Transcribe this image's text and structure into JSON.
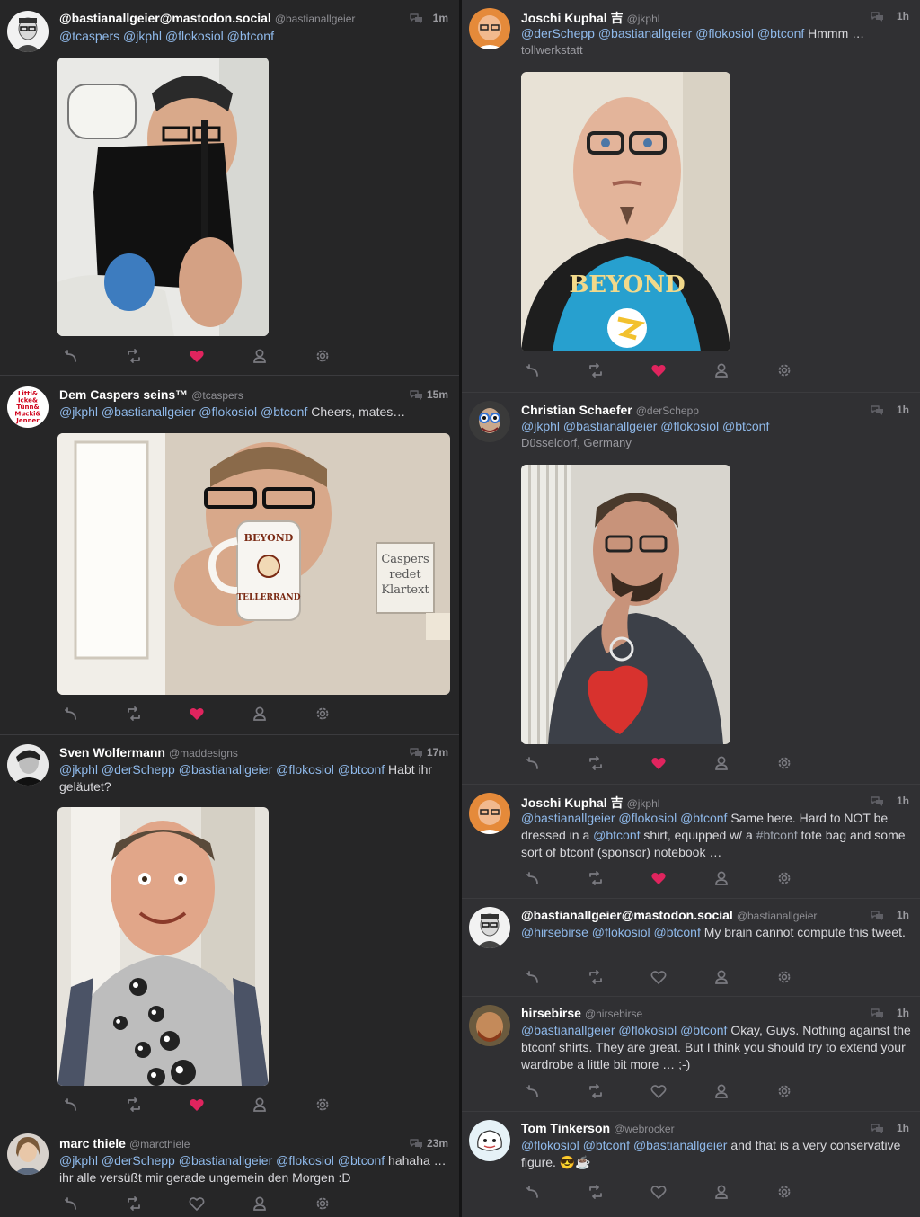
{
  "left_column": [
    {
      "name": "@bastianallgeier@mastodon.social",
      "handle": "@bastianallgeier",
      "time": "1m",
      "text_parts": [
        {
          "t": "@tcaspers",
          "k": "mention"
        },
        {
          "t": " ",
          "k": "text"
        },
        {
          "t": "@jkphl",
          "k": "mention"
        },
        {
          "t": " ",
          "k": "text"
        },
        {
          "t": "@flokosiol",
          "k": "mention"
        },
        {
          "t": " ",
          "k": "text"
        },
        {
          "t": "@btconf",
          "k": "mention"
        }
      ],
      "has_photo": true,
      "liked": true,
      "avatar_icon": "person-glasses-avatar"
    },
    {
      "name": "Dem Caspers seins™",
      "handle": "@tcaspers",
      "time": "15m",
      "text_parts": [
        {
          "t": "@jkphl",
          "k": "mention"
        },
        {
          "t": " ",
          "k": "text"
        },
        {
          "t": "@bastianallgeier",
          "k": "mention"
        },
        {
          "t": " ",
          "k": "text"
        },
        {
          "t": "@flokosiol",
          "k": "mention"
        },
        {
          "t": " ",
          "k": "text"
        },
        {
          "t": "@btconf",
          "k": "mention"
        },
        {
          "t": " Cheers, mates…",
          "k": "text"
        }
      ],
      "has_photo": true,
      "liked": true,
      "avatar_text": [
        "Litti&",
        "Icke&",
        "Tünn&",
        "Mucki&",
        "Jenner"
      ],
      "photo_texts": [
        "BEYOND",
        "TELLERRAND",
        "Caspers",
        "redet",
        "Klartext"
      ]
    },
    {
      "name": "Sven Wolfermann",
      "handle": "@maddesigns",
      "time": "17m",
      "text_parts": [
        {
          "t": "@jkphl",
          "k": "mention"
        },
        {
          "t": " ",
          "k": "text"
        },
        {
          "t": "@derSchepp",
          "k": "mention"
        },
        {
          "t": " ",
          "k": "text"
        },
        {
          "t": "@bastianallgeier",
          "k": "mention"
        },
        {
          "t": " ",
          "k": "text"
        },
        {
          "t": "@flokosiol",
          "k": "mention"
        },
        {
          "t": " ",
          "k": "text"
        },
        {
          "t": "@btconf",
          "k": "mention"
        },
        {
          "t": " Habt ihr geläutet?",
          "k": "text"
        }
      ],
      "has_photo": true,
      "liked": true
    },
    {
      "name": "marc thiele",
      "handle": "@marcthiele",
      "time": "23m",
      "text_parts": [
        {
          "t": "@jkphl",
          "k": "mention"
        },
        {
          "t": " ",
          "k": "text"
        },
        {
          "t": "@derSchepp",
          "k": "mention"
        },
        {
          "t": " ",
          "k": "text"
        },
        {
          "t": "@bastianallgeier",
          "k": "mention"
        },
        {
          "t": " ",
          "k": "text"
        },
        {
          "t": "@flokosiol",
          "k": "mention"
        },
        {
          "t": " ",
          "k": "text"
        },
        {
          "t": "@btconf",
          "k": "mention"
        },
        {
          "t": " hahaha … ihr alle versüßt mir gerade ungemein den Morgen :D",
          "k": "text"
        }
      ],
      "has_photo": false,
      "liked": false
    }
  ],
  "right_column": [
    {
      "name": "Joschi Kuphal 吉",
      "handle": "@jkphl",
      "time": "1h",
      "text_parts": [
        {
          "t": "@derSchepp",
          "k": "mention"
        },
        {
          "t": " ",
          "k": "text"
        },
        {
          "t": "@bastianallgeier",
          "k": "mention"
        },
        {
          "t": " ",
          "k": "text"
        },
        {
          "t": "@flokosiol",
          "k": "mention"
        },
        {
          "t": " ",
          "k": "text"
        },
        {
          "t": "@btconf",
          "k": "mention"
        },
        {
          "t": " Hmmm …",
          "k": "text"
        }
      ],
      "place": "tollwerkstatt",
      "has_photo": true,
      "liked": true,
      "photo_texts": [
        "BEYOND"
      ]
    },
    {
      "name": "Christian Schaefer",
      "handle": "@derSchepp",
      "time": "1h",
      "text_parts": [
        {
          "t": "@jkphl",
          "k": "mention"
        },
        {
          "t": " ",
          "k": "text"
        },
        {
          "t": "@bastianallgeier",
          "k": "mention"
        },
        {
          "t": " ",
          "k": "text"
        },
        {
          "t": "@flokosiol",
          "k": "mention"
        },
        {
          "t": " ",
          "k": "text"
        },
        {
          "t": "@btconf",
          "k": "mention"
        }
      ],
      "place": "Düsseldorf, Germany",
      "has_photo": true,
      "liked": true
    },
    {
      "name": "Joschi Kuphal 吉",
      "handle": "@jkphl",
      "time": "1h",
      "text_parts": [
        {
          "t": "@bastianallgeier",
          "k": "mention"
        },
        {
          "t": " ",
          "k": "text"
        },
        {
          "t": "@flokosiol",
          "k": "mention"
        },
        {
          "t": " ",
          "k": "text"
        },
        {
          "t": "@btconf",
          "k": "mention"
        },
        {
          "t": " Same here. Hard to NOT be dressed in a ",
          "k": "text"
        },
        {
          "t": "@btconf",
          "k": "mention"
        },
        {
          "t": " shirt, equipped w/ a ",
          "k": "text"
        },
        {
          "t": "#btconf",
          "k": "hashtag"
        },
        {
          "t": " tote bag and some sort of btconf (sponsor) notebook …",
          "k": "text"
        }
      ],
      "has_photo": false,
      "liked": true
    },
    {
      "name": "@bastianallgeier@mastodon.social",
      "handle": "@bastianallgeier",
      "time": "1h",
      "text_parts": [
        {
          "t": "@hirsebirse",
          "k": "mention"
        },
        {
          "t": " ",
          "k": "text"
        },
        {
          "t": "@flokosiol",
          "k": "mention"
        },
        {
          "t": " ",
          "k": "text"
        },
        {
          "t": "@btconf",
          "k": "mention"
        },
        {
          "t": " My brain cannot compute this tweet.",
          "k": "text"
        }
      ],
      "has_photo": false,
      "liked": false
    },
    {
      "name": "hirsebirse",
      "handle": "@hirsebirse",
      "time": "1h",
      "text_parts": [
        {
          "t": "@bastianallgeier",
          "k": "mention"
        },
        {
          "t": " ",
          "k": "text"
        },
        {
          "t": "@flokosiol",
          "k": "mention"
        },
        {
          "t": " ",
          "k": "text"
        },
        {
          "t": "@btconf",
          "k": "mention"
        },
        {
          "t": " Okay, Guys. Nothing against the btconf shirts. They are great. But I think you should try to extend your wardrobe a little bit more … ;-)",
          "k": "text"
        }
      ],
      "has_photo": false,
      "liked": false
    },
    {
      "name": "Tom Tinkerson",
      "handle": "@webrocker",
      "time": "1h",
      "text_parts": [
        {
          "t": "@flokosiol",
          "k": "mention"
        },
        {
          "t": " ",
          "k": "text"
        },
        {
          "t": "@btconf",
          "k": "mention"
        },
        {
          "t": " ",
          "k": "text"
        },
        {
          "t": "@bastianallgeier",
          "k": "mention"
        },
        {
          "t": " and that is a very conservative figure. 😎☕",
          "k": "text"
        }
      ],
      "has_photo": false,
      "liked": false
    }
  ],
  "colors": {
    "left_bg": "#262627",
    "right_bg": "#303033",
    "mention": "#8fb9ea",
    "like_active": "#e0245e",
    "icon": "#7a7a80"
  },
  "action_icons": [
    "reply-icon",
    "retweet-icon",
    "like-icon",
    "follow-icon",
    "settings-icon"
  ]
}
